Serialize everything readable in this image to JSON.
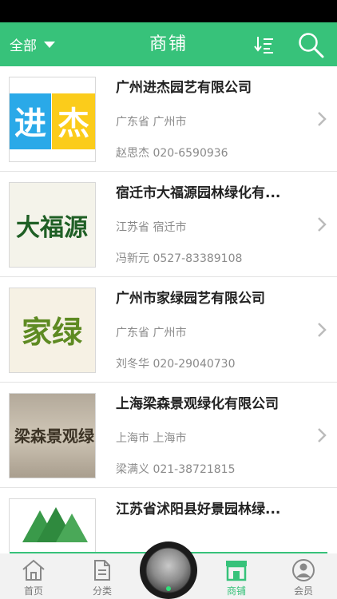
{
  "header": {
    "filter_label": "全部",
    "title": "商铺",
    "accent_color": "#37c27a"
  },
  "shops": [
    {
      "name": "广州进杰园艺有限公司",
      "region": "广东省 广州市",
      "contact": "赵思杰 020-6590936",
      "logo_text": [
        "进",
        "杰"
      ]
    },
    {
      "name": "宿迁市大福源园林绿化有...",
      "region": "江苏省 宿迁市",
      "contact": "冯新元 0527-83389108",
      "logo_text": "大福源"
    },
    {
      "name": "广州市家绿园艺有限公司",
      "region": "广东省 广州市",
      "contact": "刘冬华  020-29040730",
      "logo_text": "家绿"
    },
    {
      "name": "上海梁森景观绿化有限公司",
      "region": "上海市 上海市",
      "contact": "梁满义 021-38721815",
      "logo_text": "梁森景观绿"
    },
    {
      "name": "江苏省沭阳县好景园林绿...",
      "region": "",
      "contact": ""
    }
  ],
  "tabs": [
    {
      "label": "首页",
      "icon": "home-icon"
    },
    {
      "label": "分类",
      "icon": "category-icon"
    },
    {
      "label": "商铺",
      "icon": "shop-icon",
      "active": true
    },
    {
      "label": "会员",
      "icon": "member-icon"
    }
  ]
}
